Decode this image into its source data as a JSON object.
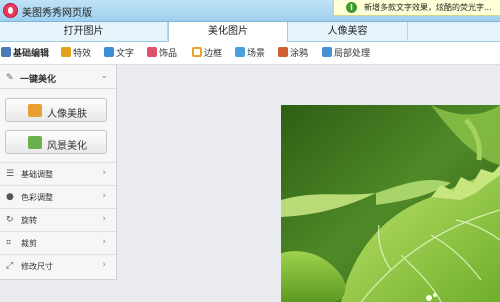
{
  "app": {
    "title": "美图秀秀网页版"
  },
  "notice": {
    "icon": "i",
    "text": "新增多款文字效果，炫酷的荧光字..."
  },
  "tabs": [
    {
      "label": "打开图片"
    },
    {
      "label": "美化图片",
      "active": true
    },
    {
      "label": "人像美容"
    }
  ],
  "toolbar": [
    {
      "label": "基础编辑",
      "icon": "edit-icon",
      "active": true,
      "color": "#4a7ab8"
    },
    {
      "label": "特效",
      "icon": "magic-wand-icon",
      "color": "#e0a020"
    },
    {
      "label": "文字",
      "icon": "text-icon",
      "color": "#3a8fd8"
    },
    {
      "label": "饰品",
      "icon": "bow-icon",
      "color": "#e0506a"
    },
    {
      "label": "边框",
      "icon": "frame-icon",
      "color": "#e8a030"
    },
    {
      "label": "场景",
      "icon": "scene-icon",
      "color": "#4aa0d8"
    },
    {
      "label": "涂鸦",
      "icon": "brush-icon",
      "color": "#d06030"
    },
    {
      "label": "局部处理",
      "icon": "spot-icon",
      "color": "#4a90d0"
    }
  ],
  "sidebar": {
    "header": {
      "icon": "wand-icon",
      "label": "一键美化"
    },
    "buttons": [
      {
        "label": "人像美肤",
        "icon": "portrait-icon",
        "color": "#e8a030"
      },
      {
        "label": "风景美化",
        "icon": "landscape-icon",
        "color": "#6ab04c"
      }
    ],
    "items": [
      {
        "label": "基础调整",
        "icon": "sliders-icon"
      },
      {
        "label": "色彩调整",
        "icon": "palette-icon"
      },
      {
        "label": "旋转",
        "icon": "rotate-icon"
      },
      {
        "label": "裁剪",
        "icon": "crop-icon"
      },
      {
        "label": "修改尺寸",
        "icon": "resize-icon"
      }
    ]
  }
}
